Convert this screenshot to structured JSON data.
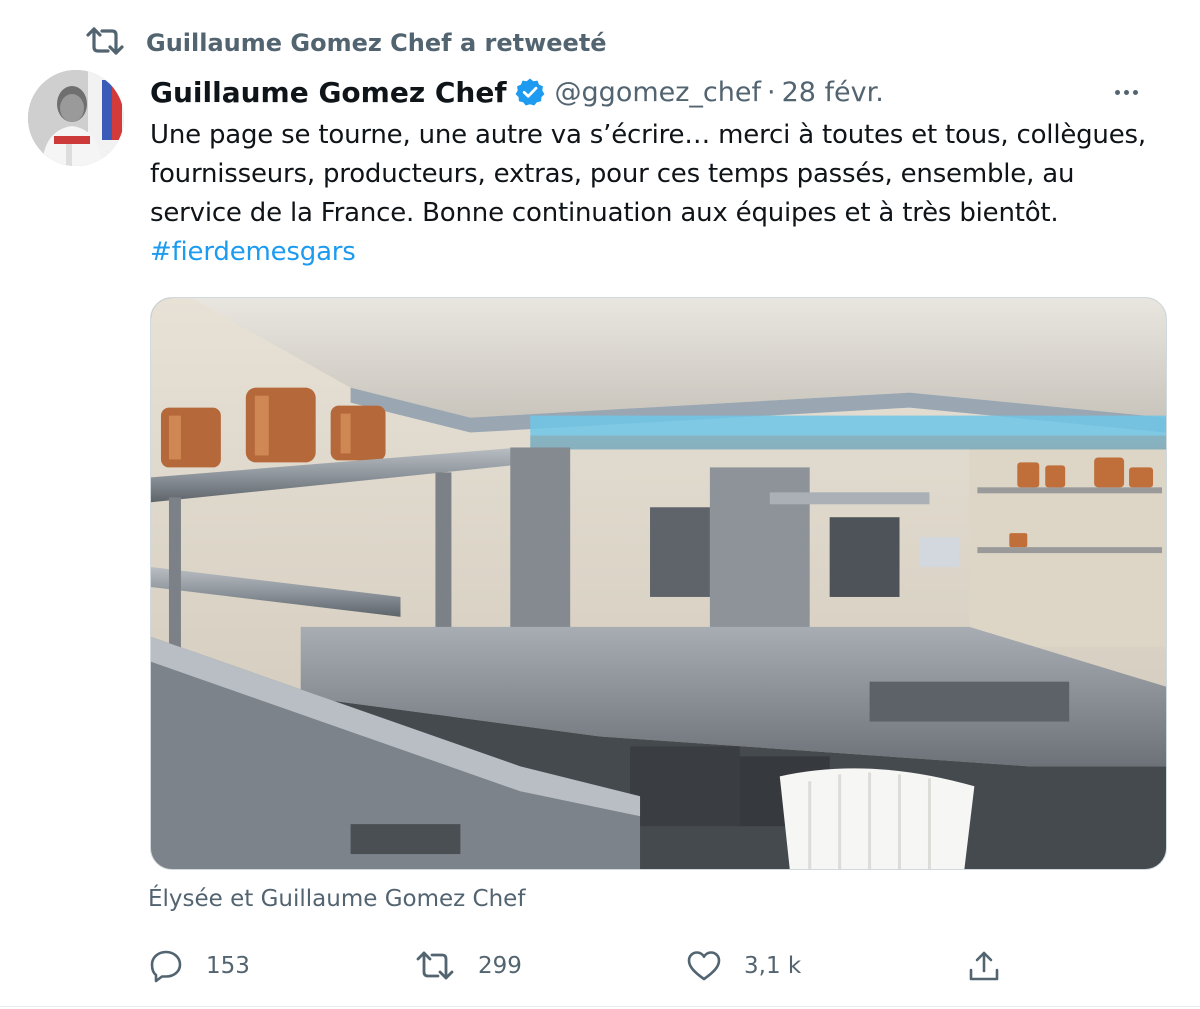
{
  "retweet_header": {
    "label": "Guillaume Gomez Chef a retweeté"
  },
  "author": {
    "name": "Guillaume Gomez Chef",
    "handle": "@ggomez_chef",
    "separator": "·",
    "date": "28 févr.",
    "verified": true
  },
  "tweet": {
    "lines": [
      "Une page se tourne, une autre va s’écrire… merci à toutes et tous, collègues,",
      "fournisseurs, producteurs, extras, pour ces temps passés, ensemble, au",
      "service de la France. Bonne continuation aux équipes et à très bientôt."
    ],
    "hashtag": "#fierdemesgars"
  },
  "media": {
    "tagged_people": "Élysée et Guillaume Gomez Chef"
  },
  "actions": {
    "replies": "153",
    "retweets": "299",
    "likes": "3,1 k"
  },
  "colors": {
    "accent": "#1d9bf0",
    "secondary_text": "#536471",
    "primary_text": "#0f1419"
  },
  "icons": [
    "retweet-icon",
    "verified-badge-icon",
    "more-icon",
    "reply-icon",
    "like-icon",
    "share-icon"
  ]
}
